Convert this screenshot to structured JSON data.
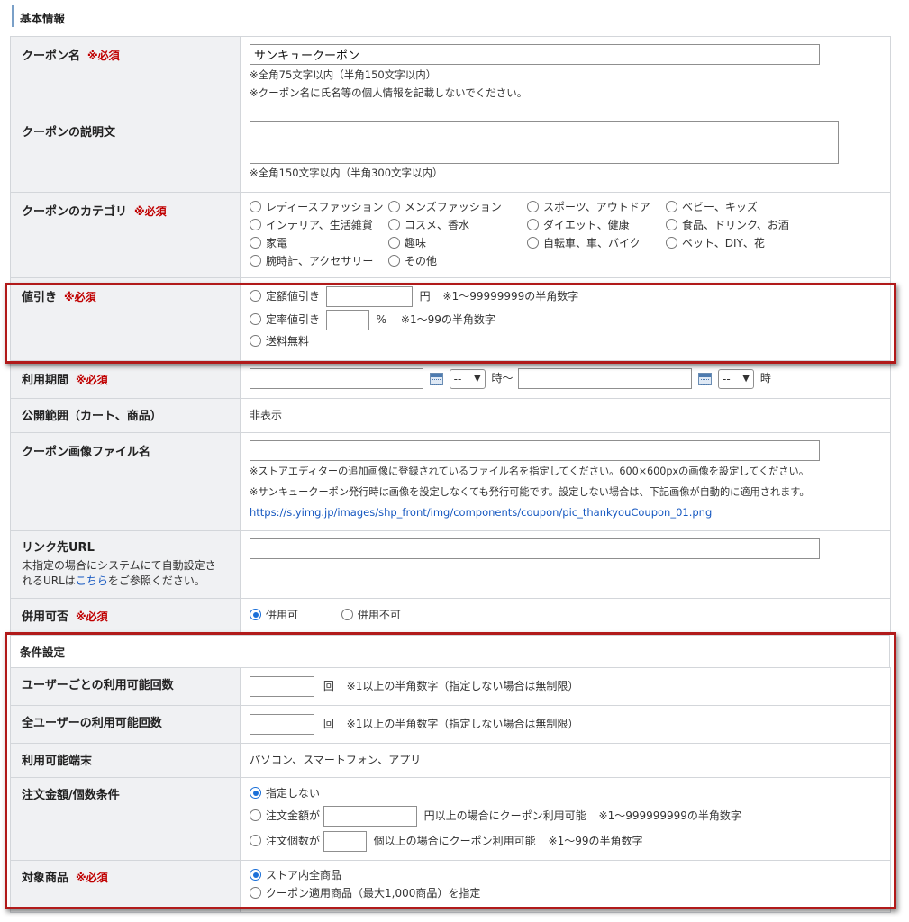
{
  "basic": {
    "heading": "基本情報",
    "required_mark": "※必須",
    "coupon_name": {
      "label": "クーポン名",
      "value": "サンキュークーポン",
      "note1": "※全角75文字以内（半角150文字以内）",
      "note2": "※クーポン名に氏名等の個人情報を記載しないでください。"
    },
    "description": {
      "label": "クーポンの説明文",
      "note": "※全角150文字以内（半角300文字以内）"
    },
    "category": {
      "label": "クーポンのカテゴリ",
      "options": [
        "レディースファッション",
        "メンズファッション",
        "スポーツ、アウトドア",
        "ベビー、キッズ",
        "インテリア、生活雑貨",
        "コスメ、香水",
        "ダイエット、健康",
        "食品、ドリンク、お酒",
        "家電",
        "趣味",
        "自転車、車、バイク",
        "ペット、DIY、花",
        "腕時計、アクセサリー",
        "その他"
      ]
    },
    "discount": {
      "label": "値引き",
      "fixed_label": "定額値引き",
      "fixed_unit": "円",
      "fixed_note": "※1～99999999の半角数字",
      "rate_label": "定率値引き",
      "rate_unit": "%",
      "rate_note": "※1～99の半角数字",
      "shipping_label": "送料無料"
    },
    "period": {
      "label": "利用期間",
      "hour_value": "--",
      "hour_sep": "時～",
      "hour_end": "時"
    },
    "scope": {
      "label": "公開範囲（カート、商品）",
      "value": "非表示"
    },
    "image": {
      "label": "クーポン画像ファイル名",
      "note1": "※ストアエディターの追加画像に登録されているファイル名を指定してください。600×600pxの画像を設定してください。",
      "note2": "※サンキュークーポン発行時は画像を設定しなくても発行可能です。設定しない場合は、下記画像が自動的に適用されます。",
      "url": "https://s.yimg.jp/images/shp_front/img/components/coupon/pic_thankyouCoupon_01.png"
    },
    "link": {
      "label": "リンク先URL",
      "sub1": "未指定の場合にシステムにて自動設定さ",
      "sub2_pre": "れるURLは",
      "sub2_link": "こちら",
      "sub2_post": "をご参照ください。"
    },
    "combine": {
      "label": "併用可否",
      "opt_yes": "併用可",
      "opt_no": "併用不可",
      "selected": "併用可"
    }
  },
  "conditions": {
    "heading": "条件設定",
    "per_user": {
      "label": "ユーザーごとの利用可能回数",
      "unit": "回",
      "note": "※1以上の半角数字（指定しない場合は無制限）"
    },
    "all_users": {
      "label": "全ユーザーの利用可能回数",
      "unit": "回",
      "note": "※1以上の半角数字（指定しない場合は無制限）"
    },
    "devices": {
      "label": "利用可能端末",
      "value": "パソコン、スマートフォン、アプリ"
    },
    "order": {
      "label": "注文金額/個数条件",
      "opt_none": "指定しない",
      "amount_pre": "注文金額が",
      "amount_post": "円以上の場合にクーポン利用可能",
      "amount_note": "※1～999999999の半角数字",
      "count_pre": "注文個数が",
      "count_post": "個以上の場合にクーポン利用可能",
      "count_note": "※1～99の半角数字",
      "selected": "指定しない"
    },
    "target": {
      "label": "対象商品",
      "opt_all": "ストア内全商品",
      "opt_specific": "クーポン適用商品（最大1,000商品）を指定",
      "selected": "ストア内全商品"
    }
  },
  "colors": {
    "highlight_border": "#b11a1a",
    "required": "#c00000",
    "link": "#1557c0",
    "label_bg": "#f0f1f3"
  }
}
